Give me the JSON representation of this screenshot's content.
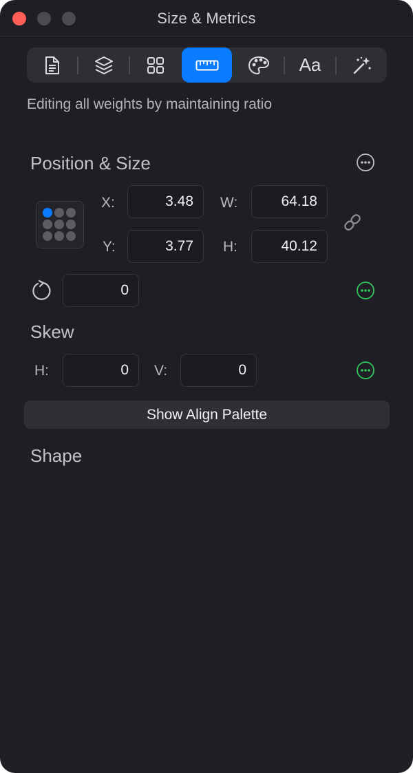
{
  "window": {
    "title": "Size & Metrics",
    "traffic_lights": [
      "close",
      "minimize",
      "maximize"
    ]
  },
  "toolbar": {
    "items": [
      {
        "icon": "document-icon",
        "active": false
      },
      {
        "icon": "layers-icon",
        "active": false
      },
      {
        "icon": "grid-icon",
        "active": false
      },
      {
        "icon": "ruler-icon",
        "active": true
      },
      {
        "icon": "palette-icon",
        "active": false
      },
      {
        "label": "Aa",
        "active": false
      },
      {
        "icon": "magic-wand-icon",
        "active": false
      }
    ]
  },
  "subtitle": "Editing all weights by maintaining ratio",
  "position_size": {
    "title": "Position & Size",
    "x_label": "X:",
    "x_value": "3.48",
    "y_label": "Y:",
    "y_value": "3.77",
    "w_label": "W:",
    "w_value": "64.18",
    "h_label": "H:",
    "h_value": "40.12",
    "rotation_value": "0"
  },
  "skew": {
    "title": "Skew",
    "h_label": "H:",
    "h_value": "0",
    "v_label": "V:",
    "v_value": "0"
  },
  "align_button_label": "Show Align Palette",
  "shape": {
    "title": "Shape"
  },
  "colors": {
    "accent": "#0a7cff",
    "window_bg": "#1e1e24",
    "action_green": "#30c85a",
    "close_red": "#fe5f57"
  }
}
